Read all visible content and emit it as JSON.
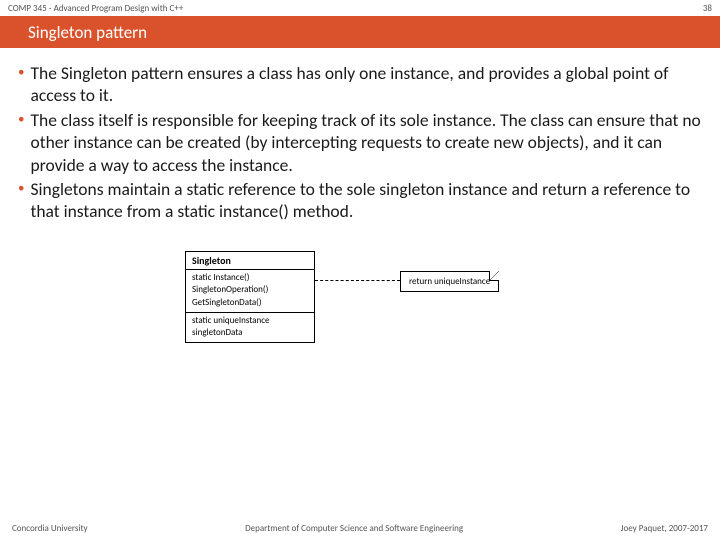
{
  "header": {
    "course": "COMP 345 - Advanced Program Design with C++",
    "slide_number": "38",
    "title": "Singleton pattern"
  },
  "bullets": [
    "The Singleton pattern ensures a class has only one instance, and provides a global point of access to it.",
    "The class itself is responsible for keeping track of its sole instance. The class can ensure that no other instance can be created (by intercepting requests to create new objects), and it can provide a way to access the instance.",
    "Singletons maintain a static reference to the sole singleton instance and return a reference to that instance from a static instance() method."
  ],
  "diagram": {
    "class_name": "Singleton",
    "ops": {
      "line1": "static Instance()",
      "line2": "SingletonOperation()",
      "line3": "GetSingletonData()"
    },
    "attrs": {
      "line1": "static uniqueInstance",
      "line2": "singletonData"
    },
    "note": "return uniqueInstance"
  },
  "footer": {
    "left": "Concordia University",
    "center": "Department of Computer Science and Software Engineering",
    "right": "Joey Paquet, 2007-2017"
  }
}
